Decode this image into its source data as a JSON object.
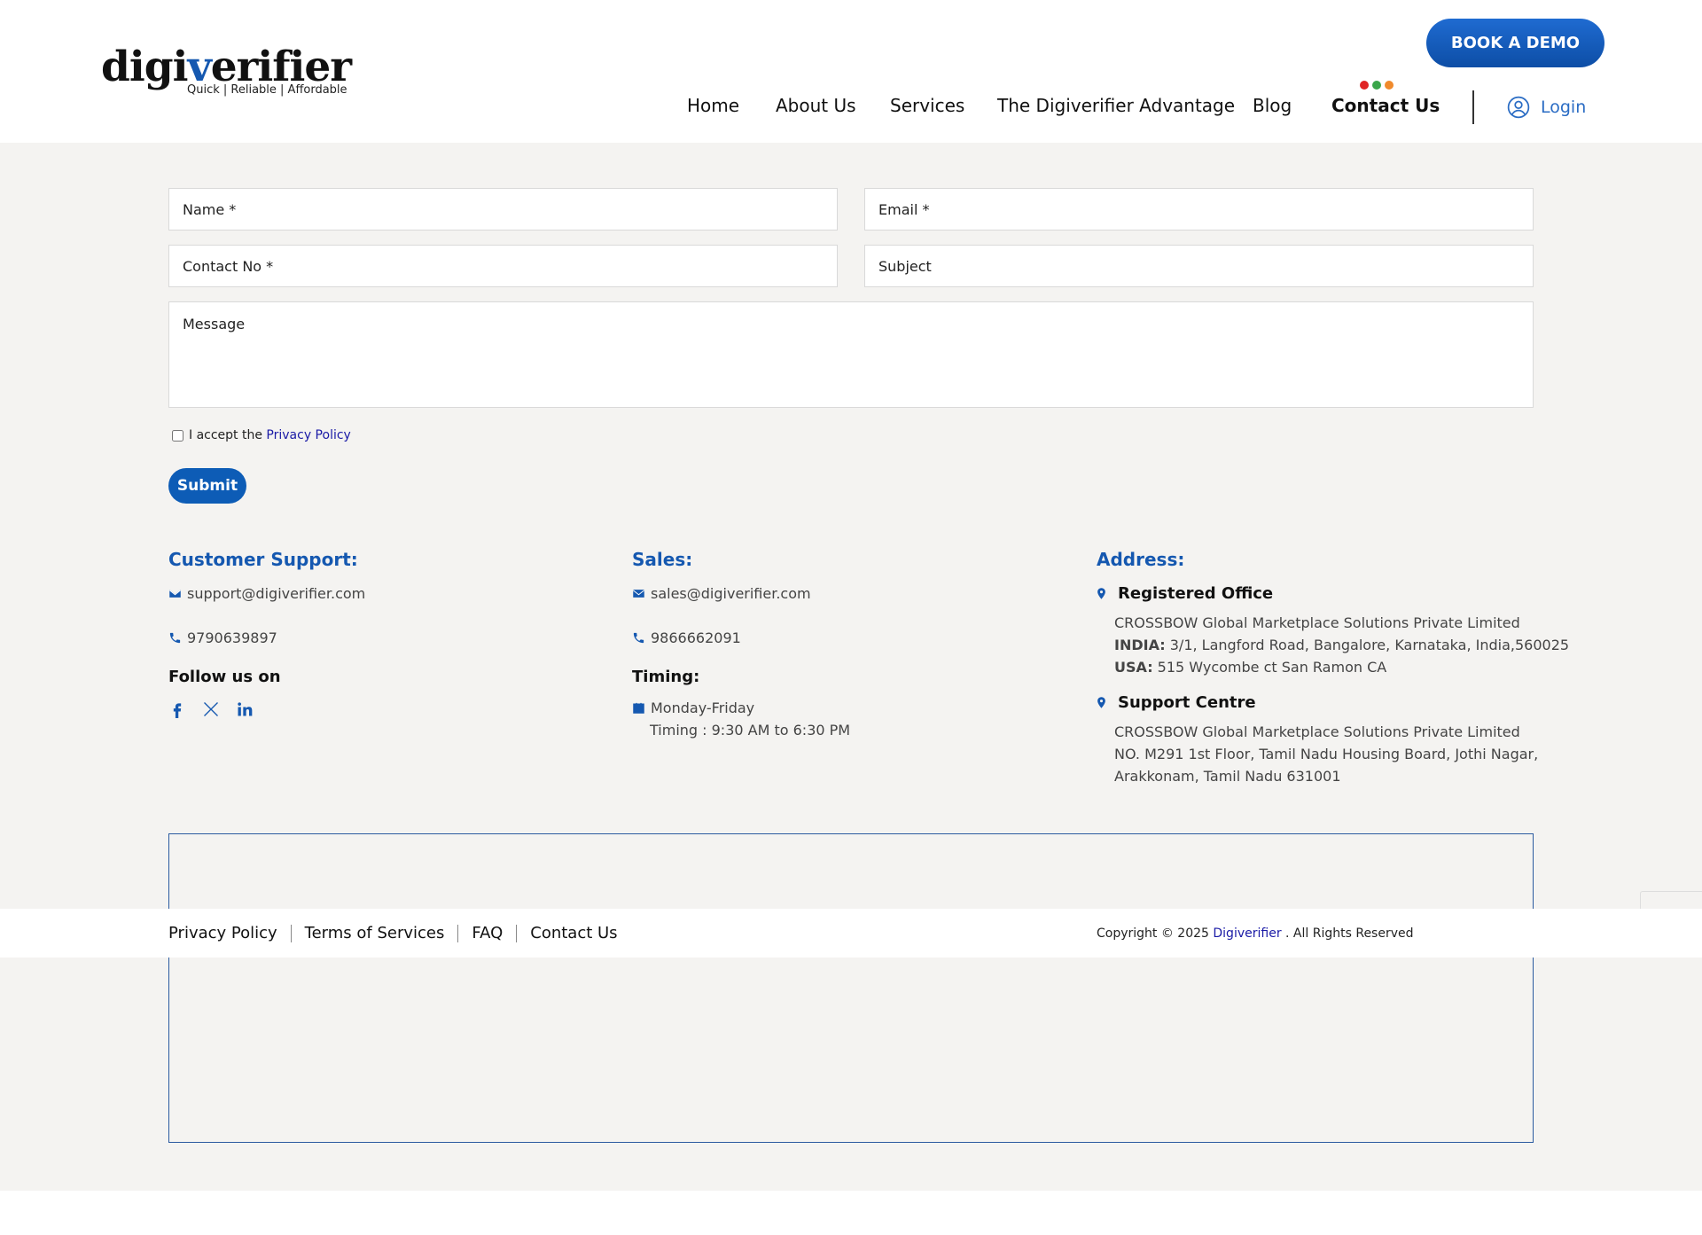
{
  "header": {
    "logo_word_prefix": "digi",
    "logo_word_v": "v",
    "logo_word_suffix": "erifier",
    "logo_tagline": "Quick | Reliable | Affordable",
    "demo_button": "BOOK A DEMO",
    "nav": [
      {
        "label": "Home",
        "active": false
      },
      {
        "label": "About Us",
        "active": false
      },
      {
        "label": "Services",
        "active": false
      },
      {
        "label": "The Digiverifier Advantage",
        "active": false
      },
      {
        "label": "Blog",
        "active": false
      },
      {
        "label": "Contact Us",
        "active": true
      }
    ],
    "active_dots_colors": [
      "#e02424",
      "#3aa64a",
      "#f08a2c"
    ],
    "login_label": "Login",
    "login_icon": "user-circle-icon"
  },
  "form": {
    "name_placeholder": "Name *",
    "email_placeholder": "Email *",
    "contact_placeholder": "Contact No *",
    "subject_placeholder": "Subject",
    "message_placeholder": "Message",
    "consent_prefix": "I accept the ",
    "consent_link": "Privacy Policy",
    "submit_label": "Submit"
  },
  "support": {
    "title": "Customer Support:",
    "email": "support@digiverifier.com",
    "phone": "9790639897",
    "follow_title": "Follow us on",
    "social_icons": [
      "facebook-icon",
      "x-twitter-icon",
      "linkedin-icon"
    ]
  },
  "sales": {
    "title": "Sales:",
    "email": "sales@digiverifier.com",
    "phone": "9866662091",
    "timing_title": "Timing:",
    "days": "Monday-Friday",
    "hours": "Timing : 9:30 AM to 6:30 PM"
  },
  "address": {
    "title": "Address:",
    "registered": {
      "title": "Registered Office",
      "company": "CROSSBOW Global Marketplace Solutions Private Limited",
      "india_label": "INDIA:",
      "india_address": " 3/1, Langford Road, Bangalore, Karnataka, India,560025",
      "usa_label": "USA:",
      "usa_address": " 515 Wycombe ct San Ramon CA"
    },
    "support_centre": {
      "title": "Support Centre",
      "company": "CROSSBOW Global Marketplace Solutions Private Limited",
      "line1": "NO. M291 1st Floor, Tamil Nadu Housing Board, Jothi Nagar,",
      "line2": "Arakkonam, Tamil Nadu 631001"
    }
  },
  "footer": {
    "links": [
      "Privacy Policy",
      "Terms of Services",
      "FAQ",
      "Contact Us"
    ],
    "copyright_prefix": "Copyright © 2025 ",
    "copyright_brand": "Digiverifier",
    "copyright_suffix": " . All Rights Reserved"
  },
  "colors": {
    "brand_blue": "#1558b0",
    "link_blue": "#1a1aa6",
    "page_bg": "#f4f3f1"
  }
}
